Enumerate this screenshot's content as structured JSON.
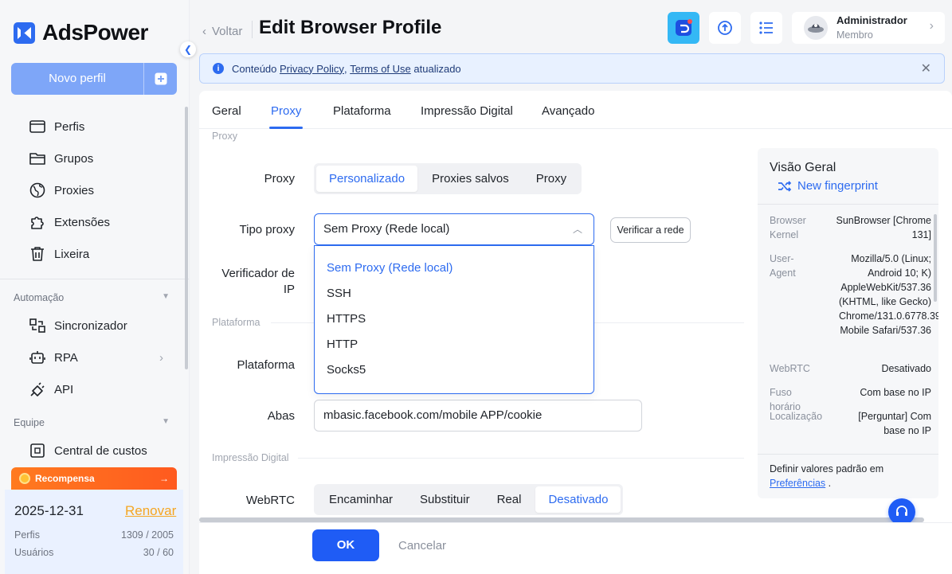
{
  "app": {
    "brand": "AdsPower",
    "accent": "#2d6bf0"
  },
  "sidebar": {
    "new_profile": "Novo perfil",
    "items": [
      {
        "label": "Perfis",
        "icon": "profiles-icon"
      },
      {
        "label": "Grupos",
        "icon": "folder-icon"
      },
      {
        "label": "Proxies",
        "icon": "globe-icon"
      },
      {
        "label": "Extensões",
        "icon": "puzzle-icon"
      },
      {
        "label": "Lixeira",
        "icon": "trash-icon"
      }
    ],
    "automation": {
      "title": "Automação",
      "items": [
        {
          "label": "Sincronizador",
          "icon": "sync-icon"
        },
        {
          "label": "RPA",
          "icon": "robot-icon"
        },
        {
          "label": "API",
          "icon": "plug-icon"
        }
      ]
    },
    "team": {
      "title": "Equipe",
      "items": [
        {
          "label": "Central de custos",
          "icon": "cost-icon"
        }
      ]
    },
    "reward": {
      "label": "Recompensa",
      "arrow": "→"
    },
    "plan": {
      "date": "2025-12-31",
      "renew": "Renovar",
      "profiles_label": "Perfis",
      "profiles_value": "1309 / 2005",
      "users_label": "Usuários",
      "users_value": "30 / 60"
    }
  },
  "header": {
    "back": "Voltar",
    "title": "Edit Browser Profile",
    "user": {
      "name": "Administrador",
      "role": "Membro"
    }
  },
  "banner": {
    "prefix": "Conteúdo",
    "link1": "Privacy Policy",
    "sep": ",",
    "link2": "Terms of Use",
    "suffix": "atualizado"
  },
  "tabs": [
    "Geral",
    "Proxy",
    "Plataforma",
    "Impressão Digital",
    "Avançado"
  ],
  "active_tab": "Proxy",
  "form": {
    "section_proxy": "Proxy",
    "proxy_label": "Proxy",
    "proxy_options": [
      "Personalizado",
      "Proxies salvos",
      "Proxy"
    ],
    "proxy_selected": "Personalizado",
    "proxy_type_label": "Tipo proxy",
    "proxy_type_value": "Sem Proxy (Rede local)",
    "check_network": "Verificar a rede",
    "ip_checker_label_1": "Verificador de",
    "ip_checker_label_2": "IP",
    "dropdown_options": [
      "Sem Proxy (Rede local)",
      "SSH",
      "HTTPS",
      "HTTP",
      "Socks5"
    ],
    "section_platform": "Plataforma",
    "platform_label": "Plataforma",
    "tabs_label": "Abas",
    "tabs_value": "mbasic.facebook.com/mobile APP/cookie",
    "section_fingerprint": "Impressão Digital",
    "webrtc_label": "WebRTC",
    "webrtc_options": [
      "Encaminhar",
      "Substituir",
      "Real",
      "Desativado"
    ],
    "webrtc_selected": "Desativado"
  },
  "overview": {
    "title": "Visão Geral",
    "new_fingerprint": "New fingerprint",
    "rows": [
      {
        "key": "Browser Kernel",
        "value": "SunBrowser [Chrome 131]"
      },
      {
        "key": "User-Agent",
        "value": "Mozilla/5.0 (Linux; Android 10; K) AppleWebKit/537.36 (KHTML, like Gecko) Chrome/131.0.6778.39 Mobile Safari/537.36"
      },
      {
        "key": "WebRTC",
        "value": "Desativado"
      },
      {
        "key": "Fuso horário",
        "value": "Com base no IP"
      },
      {
        "key": "Localização",
        "value": "[Perguntar] Com base no IP"
      }
    ],
    "footer_text": "Definir valores padrão em",
    "footer_link": "Preferências",
    "footer_end": "."
  },
  "footer": {
    "ok": "OK",
    "cancel": "Cancelar"
  }
}
